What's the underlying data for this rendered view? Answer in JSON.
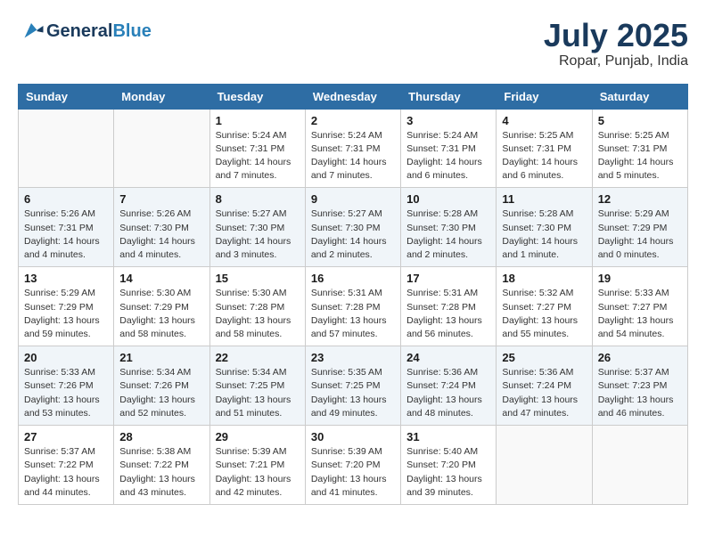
{
  "header": {
    "logo_general": "General",
    "logo_blue": "Blue",
    "month_year": "July 2025",
    "location": "Ropar, Punjab, India"
  },
  "weekdays": [
    "Sunday",
    "Monday",
    "Tuesday",
    "Wednesday",
    "Thursday",
    "Friday",
    "Saturday"
  ],
  "weeks": [
    [
      {
        "day": "",
        "info": ""
      },
      {
        "day": "",
        "info": ""
      },
      {
        "day": "1",
        "info": "Sunrise: 5:24 AM\nSunset: 7:31 PM\nDaylight: 14 hours\nand 7 minutes."
      },
      {
        "day": "2",
        "info": "Sunrise: 5:24 AM\nSunset: 7:31 PM\nDaylight: 14 hours\nand 7 minutes."
      },
      {
        "day": "3",
        "info": "Sunrise: 5:24 AM\nSunset: 7:31 PM\nDaylight: 14 hours\nand 6 minutes."
      },
      {
        "day": "4",
        "info": "Sunrise: 5:25 AM\nSunset: 7:31 PM\nDaylight: 14 hours\nand 6 minutes."
      },
      {
        "day": "5",
        "info": "Sunrise: 5:25 AM\nSunset: 7:31 PM\nDaylight: 14 hours\nand 5 minutes."
      }
    ],
    [
      {
        "day": "6",
        "info": "Sunrise: 5:26 AM\nSunset: 7:31 PM\nDaylight: 14 hours\nand 4 minutes."
      },
      {
        "day": "7",
        "info": "Sunrise: 5:26 AM\nSunset: 7:30 PM\nDaylight: 14 hours\nand 4 minutes."
      },
      {
        "day": "8",
        "info": "Sunrise: 5:27 AM\nSunset: 7:30 PM\nDaylight: 14 hours\nand 3 minutes."
      },
      {
        "day": "9",
        "info": "Sunrise: 5:27 AM\nSunset: 7:30 PM\nDaylight: 14 hours\nand 2 minutes."
      },
      {
        "day": "10",
        "info": "Sunrise: 5:28 AM\nSunset: 7:30 PM\nDaylight: 14 hours\nand 2 minutes."
      },
      {
        "day": "11",
        "info": "Sunrise: 5:28 AM\nSunset: 7:30 PM\nDaylight: 14 hours\nand 1 minute."
      },
      {
        "day": "12",
        "info": "Sunrise: 5:29 AM\nSunset: 7:29 PM\nDaylight: 14 hours\nand 0 minutes."
      }
    ],
    [
      {
        "day": "13",
        "info": "Sunrise: 5:29 AM\nSunset: 7:29 PM\nDaylight: 13 hours\nand 59 minutes."
      },
      {
        "day": "14",
        "info": "Sunrise: 5:30 AM\nSunset: 7:29 PM\nDaylight: 13 hours\nand 58 minutes."
      },
      {
        "day": "15",
        "info": "Sunrise: 5:30 AM\nSunset: 7:28 PM\nDaylight: 13 hours\nand 58 minutes."
      },
      {
        "day": "16",
        "info": "Sunrise: 5:31 AM\nSunset: 7:28 PM\nDaylight: 13 hours\nand 57 minutes."
      },
      {
        "day": "17",
        "info": "Sunrise: 5:31 AM\nSunset: 7:28 PM\nDaylight: 13 hours\nand 56 minutes."
      },
      {
        "day": "18",
        "info": "Sunrise: 5:32 AM\nSunset: 7:27 PM\nDaylight: 13 hours\nand 55 minutes."
      },
      {
        "day": "19",
        "info": "Sunrise: 5:33 AM\nSunset: 7:27 PM\nDaylight: 13 hours\nand 54 minutes."
      }
    ],
    [
      {
        "day": "20",
        "info": "Sunrise: 5:33 AM\nSunset: 7:26 PM\nDaylight: 13 hours\nand 53 minutes."
      },
      {
        "day": "21",
        "info": "Sunrise: 5:34 AM\nSunset: 7:26 PM\nDaylight: 13 hours\nand 52 minutes."
      },
      {
        "day": "22",
        "info": "Sunrise: 5:34 AM\nSunset: 7:25 PM\nDaylight: 13 hours\nand 51 minutes."
      },
      {
        "day": "23",
        "info": "Sunrise: 5:35 AM\nSunset: 7:25 PM\nDaylight: 13 hours\nand 49 minutes."
      },
      {
        "day": "24",
        "info": "Sunrise: 5:36 AM\nSunset: 7:24 PM\nDaylight: 13 hours\nand 48 minutes."
      },
      {
        "day": "25",
        "info": "Sunrise: 5:36 AM\nSunset: 7:24 PM\nDaylight: 13 hours\nand 47 minutes."
      },
      {
        "day": "26",
        "info": "Sunrise: 5:37 AM\nSunset: 7:23 PM\nDaylight: 13 hours\nand 46 minutes."
      }
    ],
    [
      {
        "day": "27",
        "info": "Sunrise: 5:37 AM\nSunset: 7:22 PM\nDaylight: 13 hours\nand 44 minutes."
      },
      {
        "day": "28",
        "info": "Sunrise: 5:38 AM\nSunset: 7:22 PM\nDaylight: 13 hours\nand 43 minutes."
      },
      {
        "day": "29",
        "info": "Sunrise: 5:39 AM\nSunset: 7:21 PM\nDaylight: 13 hours\nand 42 minutes."
      },
      {
        "day": "30",
        "info": "Sunrise: 5:39 AM\nSunset: 7:20 PM\nDaylight: 13 hours\nand 41 minutes."
      },
      {
        "day": "31",
        "info": "Sunrise: 5:40 AM\nSunset: 7:20 PM\nDaylight: 13 hours\nand 39 minutes."
      },
      {
        "day": "",
        "info": ""
      },
      {
        "day": "",
        "info": ""
      }
    ]
  ]
}
